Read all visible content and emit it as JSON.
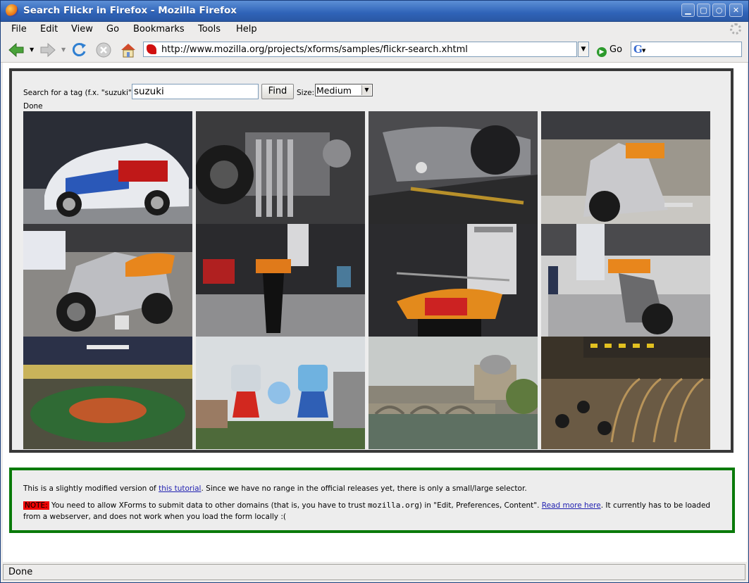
{
  "window": {
    "title": "Search Flickr in Firefox - Mozilla Firefox"
  },
  "menu": [
    "File",
    "Edit",
    "View",
    "Go",
    "Bookmarks",
    "Tools",
    "Help"
  ],
  "navbar": {
    "url": "http://www.mozilla.org/projects/xforms/samples/flickr-search.xhtml",
    "go_label": "Go",
    "search_engine_icon": "google-icon"
  },
  "form": {
    "label": "Search for a tag (f.x. \"suzuki\"):",
    "query": "suzuki",
    "find_label": "Find",
    "size_label": "Size:",
    "size_value": "Medium"
  },
  "status_inline": "Done",
  "photos": [
    "suzuki-sx4-rally-car",
    "motorcycle-engine-closeup",
    "motorcycle-frame-closeup",
    "orange-motorcycle-showfloor",
    "orange-silver-motorcycle",
    "motorcycle-rear-suzuki-booth",
    "motorcycle-taillight-suzuki-sign",
    "orange-motorcycle-crowd",
    "arena-crowd-green",
    "olympic-mascots-statue",
    "turin-bridge-river",
    "concert-hall-harps"
  ],
  "note": {
    "p1_before": "This is a slightly modified version of ",
    "p1_link": "this tutorial",
    "p1_after": ". Since we have no range in the official releases yet, there is only a small/large selector.",
    "note_label": "NOTE:",
    "p2_a": " You need to allow XForms to submit data to other domains (that is, you have to trust ",
    "p2_code": "mozilla.org",
    "p2_b": ") in \"Edit, Preferences, Content\". ",
    "p2_link": "Read more here",
    "p2_c": ". It currently has to be loaded from a webserver, and does not work when you load the form locally :("
  },
  "statusbar": "Done",
  "colors": {
    "titlebar": "#2f63b8",
    "flickr_border": "#383838",
    "note_border": "#0a7a0a",
    "note_label_bg": "#ee0000"
  }
}
